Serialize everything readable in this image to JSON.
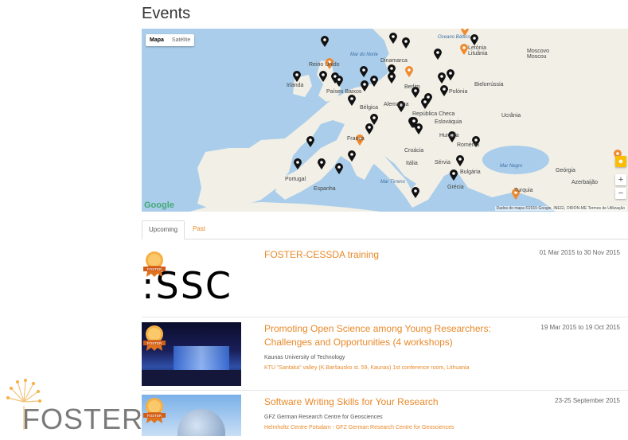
{
  "page": {
    "title": "Events"
  },
  "map": {
    "type_map": "Mapa",
    "type_satellite": "Satélite",
    "attribution": "Dados do mapa ©2015 Google, INEGI, ORION-ME   Termos de Utilização",
    "google": "Google",
    "zoom_in": "+",
    "zoom_out": "−",
    "labels": [
      "Oceano Báltico",
      "Letónia",
      "Lituânia",
      "Moscovo",
      "Moscou",
      "Mar do Norte",
      "Reino Unido",
      "Dinamarca",
      "Irlanda",
      "Bielorrússia",
      "Polónia",
      "Berlim",
      "Países Baixos",
      "Alemanha",
      "Bélgica",
      "República Checa",
      "Eslováquia",
      "Ucrânia",
      "França",
      "Hungria",
      "Roménia",
      "Croácia",
      "Sérvia",
      "Itália",
      "Bulgária",
      "Portugal",
      "Espanha",
      "Grécia",
      "Turquia",
      "Mar Negro",
      "Geórgia",
      "Azerbaijão",
      "Mar Tirreno"
    ],
    "colors": {
      "land": "#f1efe6",
      "water": "#a9cdea",
      "marker_black": "#111111",
      "marker_orange": "#ef8a2f"
    }
  },
  "tabs": {
    "upcoming": "Upcoming",
    "past": "Past"
  },
  "events": [
    {
      "title": "FOSTER-CESSDA training",
      "date": "01 Mar 2015 to 30 Nov 2015",
      "org": "",
      "location": "",
      "thumb_text": ":SSC",
      "badge": "FOSTER"
    },
    {
      "title": "Promoting Open Science among Young Researchers: Challenges and Opportunities (4 workshops)",
      "date": "19 Mar 2015 to 19 Oct 2015",
      "org": "Kaunas University of Technology",
      "location": "KTU \"Santaka\" valley (K.Baršausko st. 59, Kaunas) 1st conference room, Lithuania",
      "badge": "FOSTER"
    },
    {
      "title": "Software Writing Skills for Your Research",
      "date": "23-25 September 2015",
      "org": "GFZ German Research Centre for Geosciences",
      "location": "Helmholtz Centre Potsdam - GFZ German Research Centre for Geosciences",
      "badge": "FOSTER"
    }
  ],
  "logo": {
    "text": "FOSTER"
  }
}
